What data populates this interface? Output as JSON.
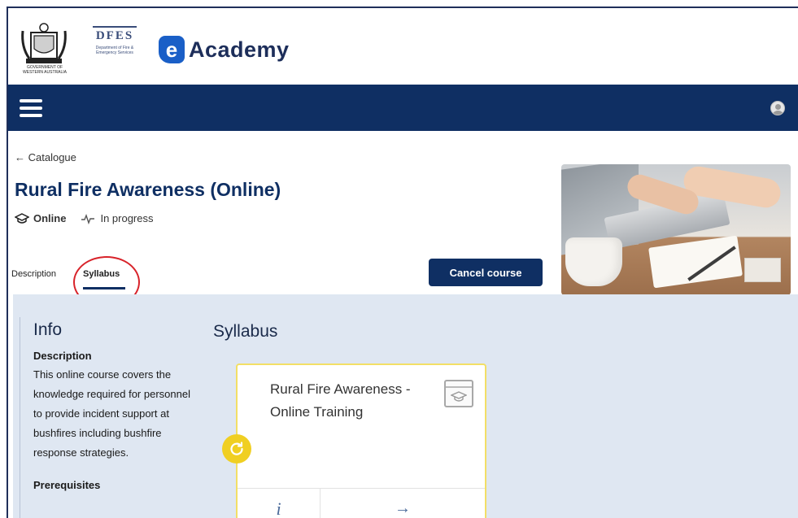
{
  "brand": {
    "crest_caption": "GOVERNMENT OF WESTERN AUSTRALIA",
    "dfes_mark": "DFES",
    "dfes_sub": "Department of Fire & Emergency Services",
    "e_letter": "e",
    "academy_word": "Academy"
  },
  "navbar": {
    "bg_color": "#0f2f63"
  },
  "course": {
    "breadcrumb": "← Catalogue",
    "title": "Rural Fire Awareness (Online)",
    "delivery": "Online",
    "status": "In progress",
    "tabs": [
      {
        "label": "Description"
      },
      {
        "label": "Syllabus"
      }
    ],
    "cancel_label": "Cancel course"
  },
  "info": {
    "heading": "Info",
    "description_label": "Description",
    "description_text": "This online course covers the knowledge required for personnel to provide incident support at bushfires including bushfire response strategies.",
    "next_label": "Prerequisites"
  },
  "syllabus": {
    "heading": "Syllabus",
    "modules": [
      {
        "title": "Rural Fire Awareness - Online Training",
        "info_glyph": "i",
        "go_glyph": "→"
      }
    ]
  },
  "colors": {
    "accent": "#0f2f63",
    "progress": "#f0cf22",
    "highlight": "#d8232a",
    "panel": "#dfe7f2"
  }
}
